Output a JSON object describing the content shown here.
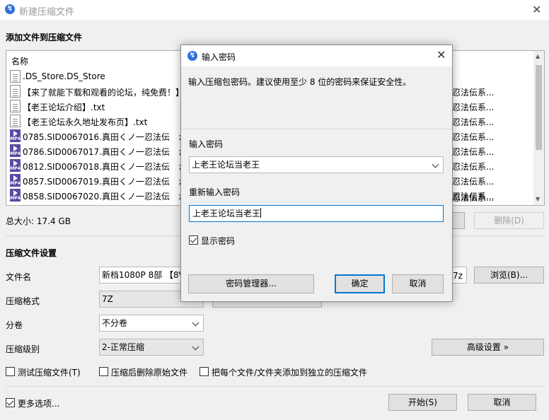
{
  "window": {
    "title": "新建压缩文件",
    "close_glyph": "✕"
  },
  "files_section": {
    "title": "添加文件到压缩文件",
    "column_name": "名称",
    "rows": [
      {
        "name": ".DS_Store.DS_Store",
        "type": "txt",
        "right": ""
      },
      {
        "name": "【来了就能下载和观看的论坛，纯免费！】",
        "type": "txt",
        "right": "忍法伝系..."
      },
      {
        "name": "【老王论坛介绍】.txt",
        "type": "txt",
        "right": "忍法伝系..."
      },
      {
        "name": "【老王论坛永久地址发布页】.txt",
        "type": "txt",
        "right": "忍法伝系..."
      },
      {
        "name": "0785.SID0067016.真田くノ一忍法伝　か",
        "type": "mp4",
        "right": "忍法伝系..."
      },
      {
        "name": "0786.SID0067017.真田くノ一忍法伝　か",
        "type": "mp4",
        "right": "忍法伝系..."
      },
      {
        "name": "0812.SID0067018.真田くノ一忍法伝　か",
        "type": "mp4",
        "right": "忍法伝系..."
      },
      {
        "name": "0857.SID0067019.真田くノ一忍法伝　か",
        "type": "mp4",
        "right": "忍法伝系..."
      },
      {
        "name": "0858.SID0067020.真田くノ一忍法伝　か",
        "type": "mp4",
        "right": "忍法伝系..."
      }
    ],
    "extra_right": "忍法伝系...",
    "total_size": "总大小: 17.4 GB",
    "delete_button": "删除(D)",
    "mp4_badge": "MP4"
  },
  "settings": {
    "title": "压缩文件设置",
    "filename_label": "文件名",
    "filename_value": "新档1080P 8部 【8V1",
    "filename_suffix": "7z",
    "browse_button": "浏览(B)...",
    "format_label": "压缩格式",
    "format_value": "7Z",
    "split_label": "分卷",
    "split_value": "不分卷",
    "level_label": "压缩级别",
    "level_value": "2-正常压缩",
    "advanced_button": "高级设置 »",
    "test_checkbox": "测试压缩文件(T)",
    "delete_after_checkbox": "压缩后删除原始文件",
    "separate_checkbox": "把每个文件/文件夹添加到独立的压缩文件",
    "more_options": "更多选项...",
    "start_button": "开始(S)",
    "cancel_button": "取消"
  },
  "dialog": {
    "title": "输入密码",
    "note": "输入压缩包密码。建议使用至少 8 位的密码来保证安全性。",
    "password_label": "输入密码",
    "password_value": "上老王论坛当老王",
    "confirm_label": "重新输入密码",
    "confirm_value": "上老王论坛当老王",
    "show_password": "显示密码",
    "show_password_checked": true,
    "manager_button": "密码管理器...",
    "ok_button": "确定",
    "cancel_button": "取消"
  },
  "colors": {
    "accent": "#0078d7",
    "app_icon": "#2f6fdc"
  }
}
